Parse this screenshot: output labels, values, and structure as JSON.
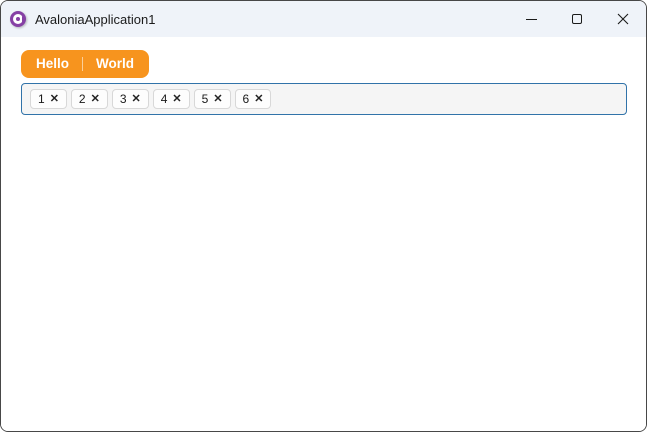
{
  "window": {
    "title": "AvaloniaApplication1",
    "controls": {
      "minimize_icon": "minimize-dash",
      "maximize_icon": "maximize-square",
      "close_icon": "close-x"
    }
  },
  "tabs": [
    {
      "label": "Hello",
      "selected": true
    },
    {
      "label": "World",
      "selected": false
    }
  ],
  "chips": {
    "items": [
      {
        "label": "1"
      },
      {
        "label": "2"
      },
      {
        "label": "3"
      },
      {
        "label": "4"
      },
      {
        "label": "5"
      },
      {
        "label": "6"
      }
    ],
    "remove_glyph": "✕"
  },
  "colors": {
    "titlebar_bg": "#eff3f9",
    "window_border": "#474747",
    "accent_orange": "#F7941E",
    "tab_text": "#ffffff",
    "chipbox_border": "#3173a9",
    "chipbox_bg": "#f5f5f5",
    "chip_bg": "#fdfdfd",
    "chip_border": "#d8d8d8",
    "logo_purple": "#8640a5"
  }
}
